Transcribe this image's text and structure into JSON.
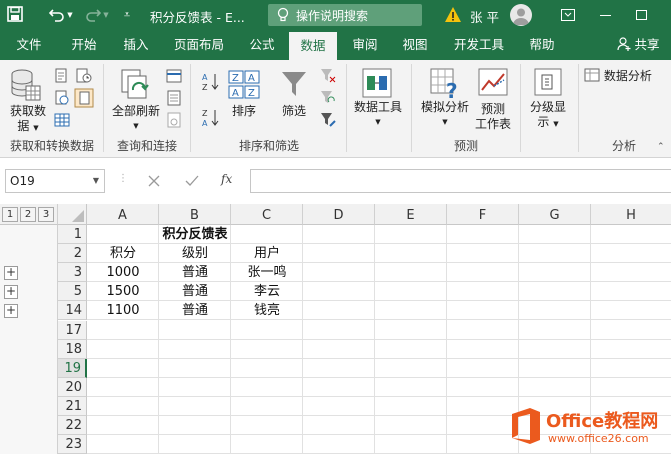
{
  "titlebar": {
    "title": "积分反馈表 - E...",
    "search_placeholder": "操作说明搜索",
    "user_name": "张平",
    "warning_icon": "warning-icon",
    "undo_icon": "undo-icon",
    "redo_icon": "redo-icon",
    "save_icon": "save-icon"
  },
  "tabs": [
    "文件",
    "开始",
    "插入",
    "页面布局",
    "公式",
    "数据",
    "审阅",
    "视图",
    "开发工具",
    "帮助"
  ],
  "active_tab": "数据",
  "share_label": "共享",
  "ribbon": {
    "get_data": "获取数\n据",
    "get_data_line1": "获取数",
    "get_data_line2": "据",
    "group_get": "获取和转换数据",
    "refresh_all": "全部刷新",
    "group_query": "查询和连接",
    "sort": "排序",
    "filter": "筛选",
    "group_sort": "排序和筛选",
    "data_tools": "数据工具",
    "whatif": "模拟分析",
    "forecast_line1": "预测",
    "forecast_line2": "工作表",
    "group_forecast": "预测",
    "outline_line1": "分级显",
    "outline_line2": "示",
    "data_analysis": "数据分析",
    "group_analysis": "分析"
  },
  "formula_bar": {
    "name_box": "O19",
    "fx": "fx",
    "value": ""
  },
  "grid": {
    "columns": [
      "A",
      "B",
      "C",
      "D",
      "E",
      "F",
      "G",
      "H"
    ],
    "outline_levels": [
      "1",
      "2",
      "3"
    ],
    "rows": [
      {
        "num": "1",
        "cells": [
          "",
          "积分反馈表",
          "",
          "",
          "",
          "",
          "",
          ""
        ],
        "expand": false
      },
      {
        "num": "2",
        "cells": [
          "积分",
          "级别",
          "用户",
          "",
          "",
          "",
          "",
          ""
        ],
        "expand": false
      },
      {
        "num": "3",
        "cells": [
          "1000",
          "普通",
          "张一鸣",
          "",
          "",
          "",
          "",
          ""
        ],
        "expand": true
      },
      {
        "num": "5",
        "cells": [
          "1500",
          "普通",
          "李云",
          "",
          "",
          "",
          "",
          ""
        ],
        "expand": true
      },
      {
        "num": "14",
        "cells": [
          "1100",
          "普通",
          "钱亮",
          "",
          "",
          "",
          "",
          ""
        ],
        "expand": true
      },
      {
        "num": "17",
        "cells": [
          "",
          "",
          "",
          "",
          "",
          "",
          "",
          ""
        ],
        "expand": false
      },
      {
        "num": "18",
        "cells": [
          "",
          "",
          "",
          "",
          "",
          "",
          "",
          ""
        ],
        "expand": false
      },
      {
        "num": "19",
        "cells": [
          "",
          "",
          "",
          "",
          "",
          "",
          "",
          ""
        ],
        "expand": false
      },
      {
        "num": "20",
        "cells": [
          "",
          "",
          "",
          "",
          "",
          "",
          "",
          ""
        ],
        "expand": false
      },
      {
        "num": "21",
        "cells": [
          "",
          "",
          "",
          "",
          "",
          "",
          "",
          ""
        ],
        "expand": false
      },
      {
        "num": "22",
        "cells": [
          "",
          "",
          "",
          "",
          "",
          "",
          "",
          ""
        ],
        "expand": false
      },
      {
        "num": "23",
        "cells": [
          "",
          "",
          "",
          "",
          "",
          "",
          "",
          ""
        ],
        "expand": false
      }
    ],
    "selected_row": "19"
  },
  "watermark": {
    "brand": "Office教程网",
    "url": "www.office26.com"
  },
  "colors": {
    "excel_green": "#217346",
    "ribbon_bg": "#f3f3f3",
    "watermark_orange": "#eb5a1e"
  }
}
